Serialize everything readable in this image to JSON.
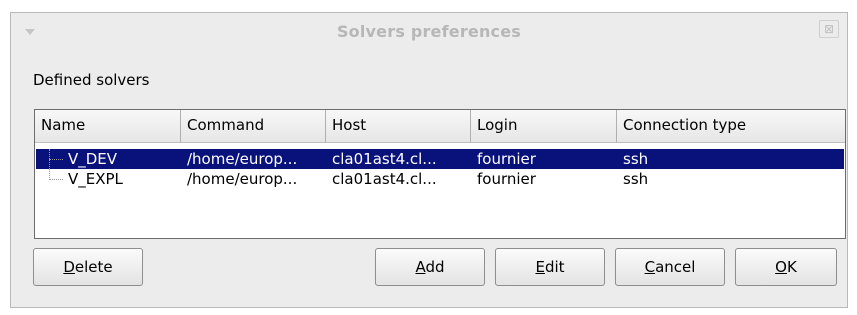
{
  "window": {
    "title": "Solvers preferences",
    "close_glyph": "⊠"
  },
  "section_label": "Defined solvers",
  "table": {
    "columns": [
      "Name",
      "Command",
      "Host",
      "Login",
      "Connection type"
    ],
    "rows": [
      {
        "name": "V_DEV",
        "command": "/home/europ...",
        "host": "cla01ast4.cl...",
        "login": "fournier",
        "connection": "ssh",
        "selected": true
      },
      {
        "name": "V_EXPL",
        "command": "/home/europ...",
        "host": "cla01ast4.cl...",
        "login": "fournier",
        "connection": "ssh",
        "selected": false
      }
    ]
  },
  "buttons": {
    "delete": {
      "mnemonic": "D",
      "rest": "elete"
    },
    "add": {
      "mnemonic": "A",
      "rest": "dd"
    },
    "edit": {
      "mnemonic": "E",
      "rest": "dit"
    },
    "cancel": {
      "mnemonic": "C",
      "rest": "ancel"
    },
    "ok": {
      "mnemonic": "O",
      "rest": "K"
    }
  },
  "colors": {
    "selection": "#08127a",
    "window_bg": "#ececec"
  }
}
